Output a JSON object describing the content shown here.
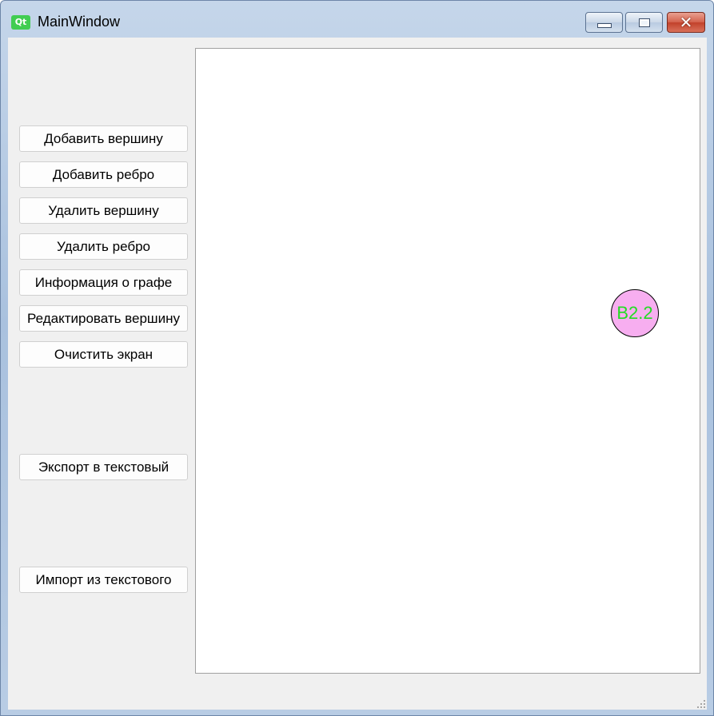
{
  "window": {
    "title": "MainWindow",
    "icon_text": "Qt",
    "icon": "qt-logo-icon"
  },
  "title_controls": {
    "minimize_icon": "minimize-icon",
    "maximize_icon": "maximize-icon",
    "close_icon": "close-icon",
    "close_glyph": "✕"
  },
  "sidebar": {
    "buttons": [
      "Добавить вершину",
      "Добавить ребро",
      "Удалить вершину",
      "Удалить ребро",
      "Информация о графе",
      "Редактировать вершину",
      "Очистить экран",
      "Экспорт в текстовый",
      "Импорт из текстового"
    ]
  },
  "canvas": {
    "vertices": [
      {
        "label": "B2.2",
        "fill": "#f7aef0",
        "text_color": "#22dd22"
      }
    ]
  },
  "colors": {
    "client_bg": "#f0f0f0",
    "canvas_bg": "#ffffff",
    "vertex_fill": "#f7aef0",
    "vertex_label": "#22dd22"
  }
}
